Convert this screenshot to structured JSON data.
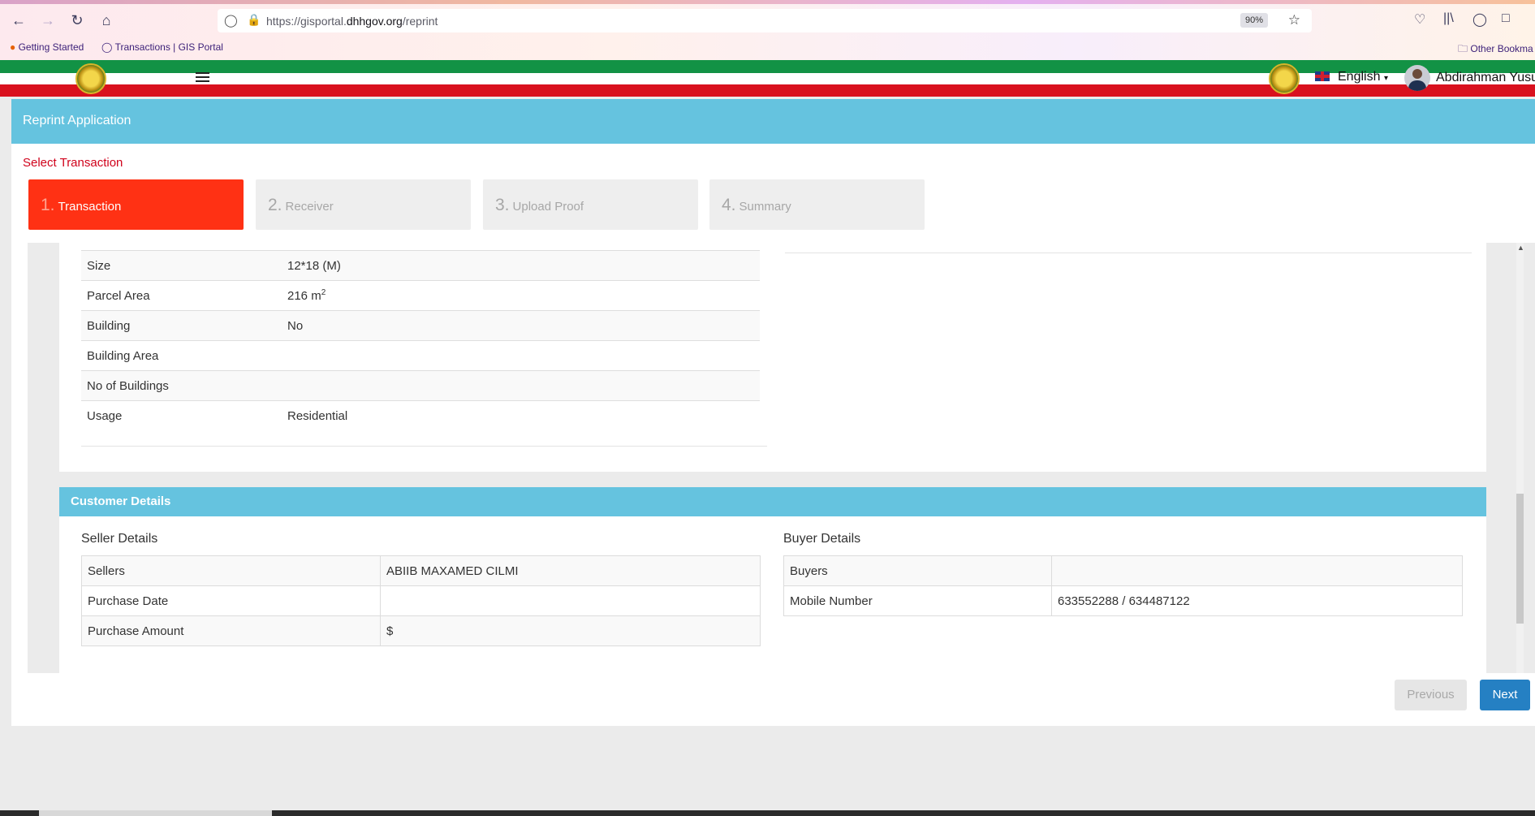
{
  "browser": {
    "url_prefix": "https://gisportal.",
    "url_domain": "dhhgov.org",
    "url_path": "/reprint",
    "zoom": "90%",
    "bookmarks": [
      "Getting Started",
      "Transactions | GIS Portal"
    ],
    "other_bookmarks": "Other Bookma"
  },
  "header": {
    "language": "English",
    "username": "Abdirahman Yusuf"
  },
  "panel": {
    "title": "Reprint Application",
    "step_title": "Select Transaction",
    "steps": [
      {
        "num": "1.",
        "label": "Transaction"
      },
      {
        "num": "2.",
        "label": "Receiver"
      },
      {
        "num": "3.",
        "label": "Upload Proof"
      },
      {
        "num": "4.",
        "label": "Summary"
      }
    ]
  },
  "property": {
    "rows": [
      {
        "label": "Size",
        "value": "12*18 (M)"
      },
      {
        "label": "Parcel Area",
        "value": "216 m",
        "sup": "2"
      },
      {
        "label": "Building",
        "value": "No"
      },
      {
        "label": "Building Area",
        "value": ""
      },
      {
        "label": "No of Buildings",
        "value": ""
      },
      {
        "label": "Usage",
        "value": "Residential"
      }
    ]
  },
  "customer": {
    "title": "Customer Details",
    "seller_title": "Seller Details",
    "seller_rows": [
      {
        "label": "Sellers",
        "value": "ABIIB MAXAMED CILMI"
      },
      {
        "label": "Purchase Date",
        "value": ""
      },
      {
        "label": "Purchase Amount",
        "value": "$"
      }
    ],
    "buyer_title": "Buyer Details",
    "buyer_rows": [
      {
        "label": "Buyers",
        "value": ""
      },
      {
        "label": "Mobile Number",
        "value": "633552288 / 634487122"
      }
    ]
  },
  "actions": {
    "previous": "Previous",
    "next": "Next"
  },
  "colors": {
    "accent": "#65c3df",
    "active_step": "#ff3114",
    "next_button": "#2580c3",
    "step_title": "#d0021b"
  }
}
